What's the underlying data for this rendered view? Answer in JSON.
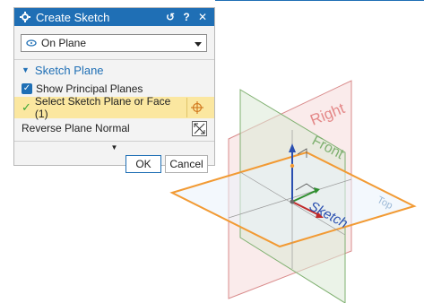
{
  "dialog": {
    "title": "Create Sketch",
    "reset_symbol": "↺",
    "help_symbol": "?",
    "close_symbol": "✕",
    "type_select": {
      "value": "On Plane"
    },
    "section": {
      "title": "Sketch Plane",
      "show_planes_label": "Show Principal Planes",
      "select_plane_label": "Select Sketch Plane or Face (1)",
      "reverse_label": "Reverse Plane Normal"
    },
    "ok_label": "OK",
    "cancel_label": "Cancel"
  },
  "planes": {
    "right": "Right",
    "front": "Front",
    "top": "Top",
    "sketch": "Sketch"
  },
  "colors": {
    "accent": "#1f6fb5",
    "highlight": "#fbe7a0",
    "right_plane": "#e7a3a3",
    "front_plane": "#a9c9a0",
    "sketch_plane": "#f29a33"
  }
}
